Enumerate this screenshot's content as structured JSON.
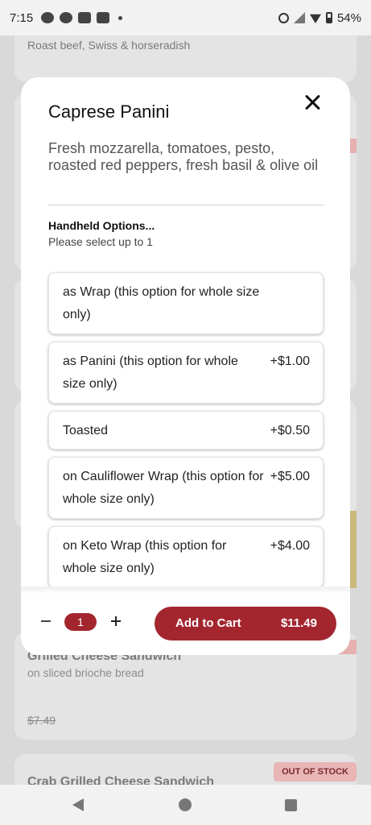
{
  "status_bar": {
    "time": "7:15",
    "battery": "54%",
    "icons": [
      "messenger-icon",
      "chat-icon",
      "youtube-icon",
      "gmail-icon",
      "alarm-icon",
      "signal-icon",
      "wifi-icon",
      "battery-icon"
    ]
  },
  "background_menu": {
    "items": [
      {
        "subtitle": "Roast beef, Swiss & horseradish"
      },
      {
        "title": "Grilled Cheese Sandwich",
        "subtitle": "on sliced brioche bread",
        "price": "$7.49"
      },
      {
        "title": "Crab Grilled Cheese Sandwich",
        "badge": "OUT OF STOCK"
      }
    ]
  },
  "modal": {
    "title": "Caprese Panini",
    "description": "Fresh mozzarella, tomatoes, pesto, roasted red peppers, fresh basil & olive oil",
    "option_group": {
      "title": "Handheld Options...",
      "subtitle": "Please select up to 1",
      "options": [
        {
          "label": "as Wrap (this option for whole size only)",
          "price": ""
        },
        {
          "label": "as Panini (this option for whole size only)",
          "price": "+$1.00"
        },
        {
          "label": "Toasted",
          "price": "+$0.50"
        },
        {
          "label": "on Cauliflower Wrap (this option for whole size only)",
          "price": "+$5.00"
        },
        {
          "label": "on Keto Wrap (this option for whole size only)",
          "price": "+$4.00"
        }
      ]
    },
    "quantity": "1",
    "add_to_cart_label": "Add to Cart",
    "total_price": "$11.49"
  },
  "colors": {
    "accent": "#a3262f",
    "badge_bg": "#e9b6b6"
  }
}
